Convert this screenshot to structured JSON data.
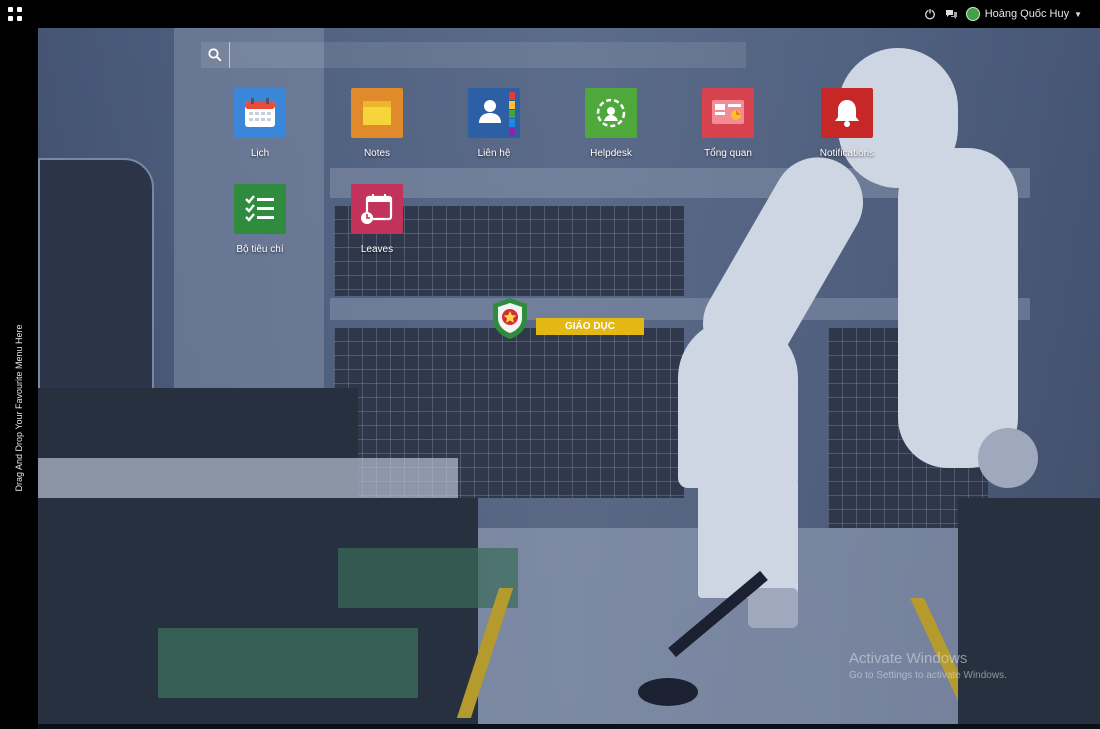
{
  "topbar": {
    "user_name": "Hoàng Quốc Huy",
    "icons": [
      "apps-grid-icon",
      "power-icon",
      "chat-icon",
      "avatar",
      "caret-down-icon"
    ]
  },
  "sidebar": {
    "drop_text": "Drag And Drop Your Favourite Menu Here"
  },
  "search": {
    "placeholder": "",
    "value": ""
  },
  "apps": [
    {
      "label": "Lịch",
      "icon": "calendar-icon",
      "color": "#3a86d8"
    },
    {
      "label": "Notes",
      "icon": "sticky-note-icon",
      "color": "#e08a2b"
    },
    {
      "label": "Liên hệ",
      "icon": "contacts-icon",
      "color": "#2c5fa4"
    },
    {
      "label": "Helpdesk",
      "icon": "helpdesk-icon",
      "color": "#4ea83b"
    },
    {
      "label": "Tổng quan",
      "icon": "dashboard-icon",
      "color": "#d6434f"
    },
    {
      "label": "Notifications",
      "icon": "bell-icon",
      "color": "#c62828"
    },
    {
      "label": "Bộ tiêu chí",
      "icon": "checklist-icon",
      "color": "#2f8c3e"
    },
    {
      "label": "Leaves",
      "icon": "leaves-icon",
      "color": "#c2335b"
    }
  ],
  "logo": {
    "band_text": "GIÁO DỤC"
  },
  "watermark": {
    "title": "Activate Windows",
    "subtitle": "Go to Settings to activate Windows."
  },
  "colors": {
    "topbar": "#000000",
    "logo_green": "#2f8c3e",
    "logo_yellow": "#e3b812"
  }
}
